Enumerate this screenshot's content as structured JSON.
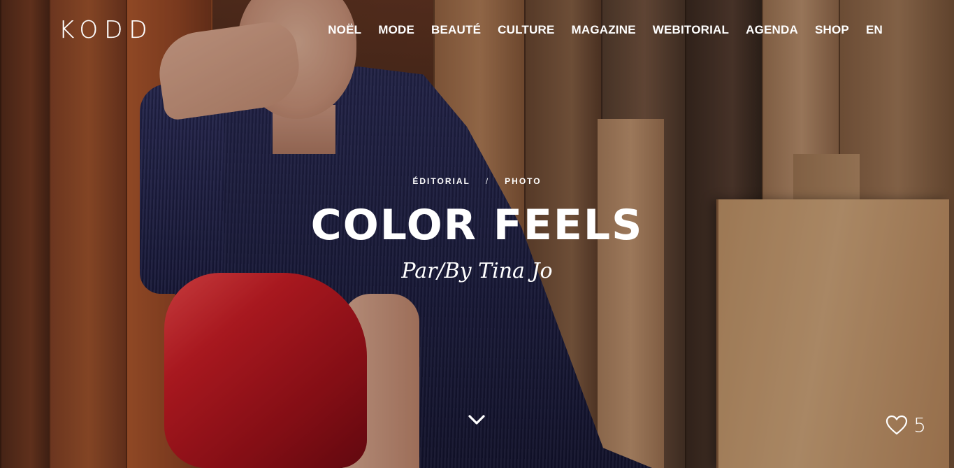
{
  "brand": {
    "logo": "KODD"
  },
  "nav": {
    "items": [
      {
        "label": "NOËL"
      },
      {
        "label": "MODE"
      },
      {
        "label": "BEAUTÉ"
      },
      {
        "label": "CULTURE"
      },
      {
        "label": "MAGAZINE"
      },
      {
        "label": "WEBITORIAL"
      },
      {
        "label": "AGENDA"
      },
      {
        "label": "SHOP"
      },
      {
        "label": "EN"
      }
    ]
  },
  "article": {
    "categories": [
      "ÉDITORIAL",
      "PHOTO"
    ],
    "separator": "/",
    "title": "COLOR FEELS",
    "byline": "Par/By Tina Jo"
  },
  "likes": {
    "count": "5",
    "icon": "heart-icon"
  },
  "scroll": {
    "icon": "chevron-down-icon"
  },
  "colors": {
    "text": "#ffffff",
    "boot_red": "#d71f28",
    "dress_navy": "#1e1f45"
  }
}
